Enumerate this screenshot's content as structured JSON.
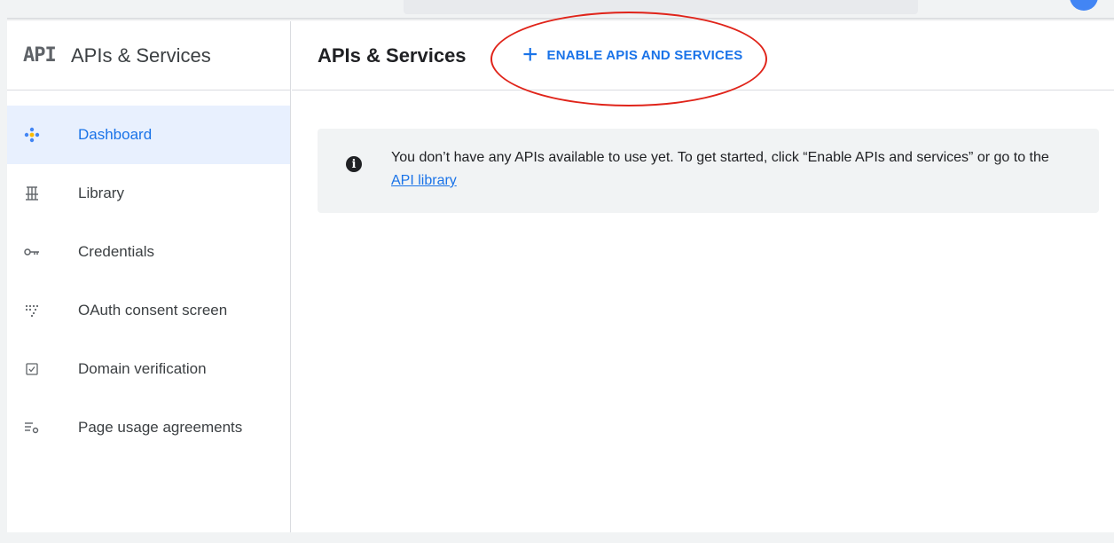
{
  "sidebar": {
    "logo": "API",
    "title": "APIs & Services",
    "items": [
      {
        "label": "Dashboard",
        "icon": "dashboard-diamond-icon",
        "active": true
      },
      {
        "label": "Library",
        "icon": "library-grid-icon"
      },
      {
        "label": "Credentials",
        "icon": "key-icon"
      },
      {
        "label": "OAuth consent screen",
        "icon": "dots-grid-icon"
      },
      {
        "label": "Domain verification",
        "icon": "checkbox-icon"
      },
      {
        "label": "Page usage agreements",
        "icon": "settings-list-icon"
      }
    ]
  },
  "main": {
    "title": "APIs & Services",
    "enable_button": {
      "icon": "+",
      "label": "ENABLE APIS AND SERVICES"
    },
    "banner": {
      "icon": "i",
      "text": "You don’t have any APIs available to use yet. To get started, click “Enable APIs and services” or go to the",
      "link": "API library"
    }
  },
  "colors": {
    "accent": "#1a73e8",
    "annotation": "#e0241a",
    "active_bg": "#e8f0fe"
  }
}
